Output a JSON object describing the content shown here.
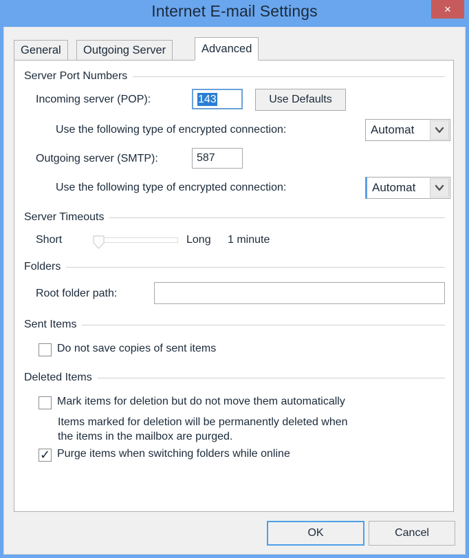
{
  "window": {
    "title": "Internet E-mail Settings",
    "close_label": "×",
    "titlebar_color": "#6aa6ee",
    "close_button_color": "#c75b5b"
  },
  "tabs": [
    {
      "label": "General",
      "active": false
    },
    {
      "label": "Outgoing Server",
      "active": false
    },
    {
      "label": "Advanced",
      "active": true
    }
  ],
  "server_port_numbers": {
    "group_label": "Server Port Numbers",
    "incoming": {
      "label": "Incoming server (POP):",
      "value": "143",
      "selected": true
    },
    "use_defaults_label": "Use Defaults",
    "incoming_encryption": {
      "label": "Use the following type of encrypted connection:",
      "value": "Automat",
      "focused": false
    },
    "outgoing": {
      "label": "Outgoing server (SMTP):",
      "value": "587"
    },
    "outgoing_encryption": {
      "label": "Use the following type of encrypted connection:",
      "value": "Automat",
      "focused": true
    }
  },
  "server_timeouts": {
    "group_label": "Server Timeouts",
    "short_label": "Short",
    "long_label": "Long",
    "value_label": "1 minute",
    "slider_position_percent": 0
  },
  "folders": {
    "group_label": "Folders",
    "root_folder_path": {
      "label": "Root folder path:",
      "value": "",
      "placeholder": ""
    }
  },
  "sent_items": {
    "group_label": "Sent Items",
    "do_not_save_copies": {
      "label": "Do not save copies of sent items",
      "checked": false
    }
  },
  "deleted_items": {
    "group_label": "Deleted Items",
    "mark_items": {
      "label": "Mark items for deletion but do not move them automatically",
      "checked": false
    },
    "hint_line1": "Items marked for deletion will be permanently deleted when",
    "hint_line2": "the items in the mailbox are purged.",
    "purge_items": {
      "label": "Purge items when switching folders while online",
      "checked": true
    }
  },
  "footer": {
    "ok_label": "OK",
    "cancel_label": "Cancel"
  },
  "icons": {
    "check": "✓",
    "chevron_down": "chevron-down-icon"
  }
}
